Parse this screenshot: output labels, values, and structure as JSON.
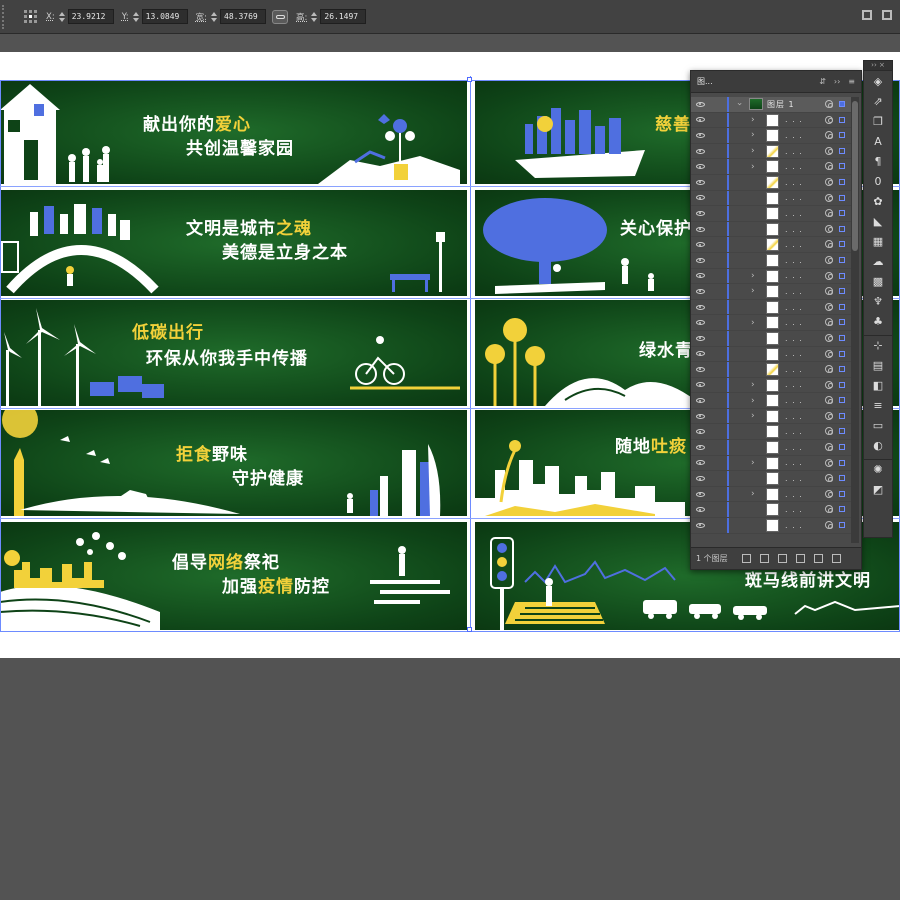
{
  "control_bar": {
    "x_label": "X:",
    "x_value": "23.9212",
    "y_label": "Y:",
    "y_value": "13.0849",
    "w_label": "宽:",
    "w_value": "48.3769",
    "h_label": "高:",
    "h_value": "26.1497"
  },
  "panels": [
    {
      "line1": "献出你的",
      "line1_hl": "爱心",
      "line2": "共创温馨家园"
    },
    {
      "line1": "文明是城市",
      "line1_hl": "之魂",
      "line2": "美德是立身之本"
    },
    {
      "line1": "低碳出行",
      "line2": "环保从你我手中传播"
    },
    {
      "line1": "拒食",
      "line1_rest": "野味",
      "line2": "守护健康"
    },
    {
      "line1": "倡导",
      "line1_hl": "网络",
      "line1_rest": "祭祀",
      "line2": "加强",
      "line2_hl": "疫情",
      "line2_rest": "防控"
    },
    {
      "line1": "慈善"
    },
    {
      "line1": "关心保护"
    },
    {
      "line1": "绿水青"
    },
    {
      "line1": "随地",
      "line1_hl": "吐痰"
    },
    {
      "line1": "斑马线前讲文明"
    }
  ],
  "layers_panel": {
    "tab_label": "图...",
    "expand_label": "››",
    "layer_name": "图层 1",
    "sublayer_name": ". . .",
    "footer_label": "1 个图层"
  },
  "colors": {
    "accent_yellow": "#f2d13a",
    "panel_green": "#0e4317",
    "art_blue": "#4f6fe0",
    "selection_blue": "#6d8bff"
  }
}
